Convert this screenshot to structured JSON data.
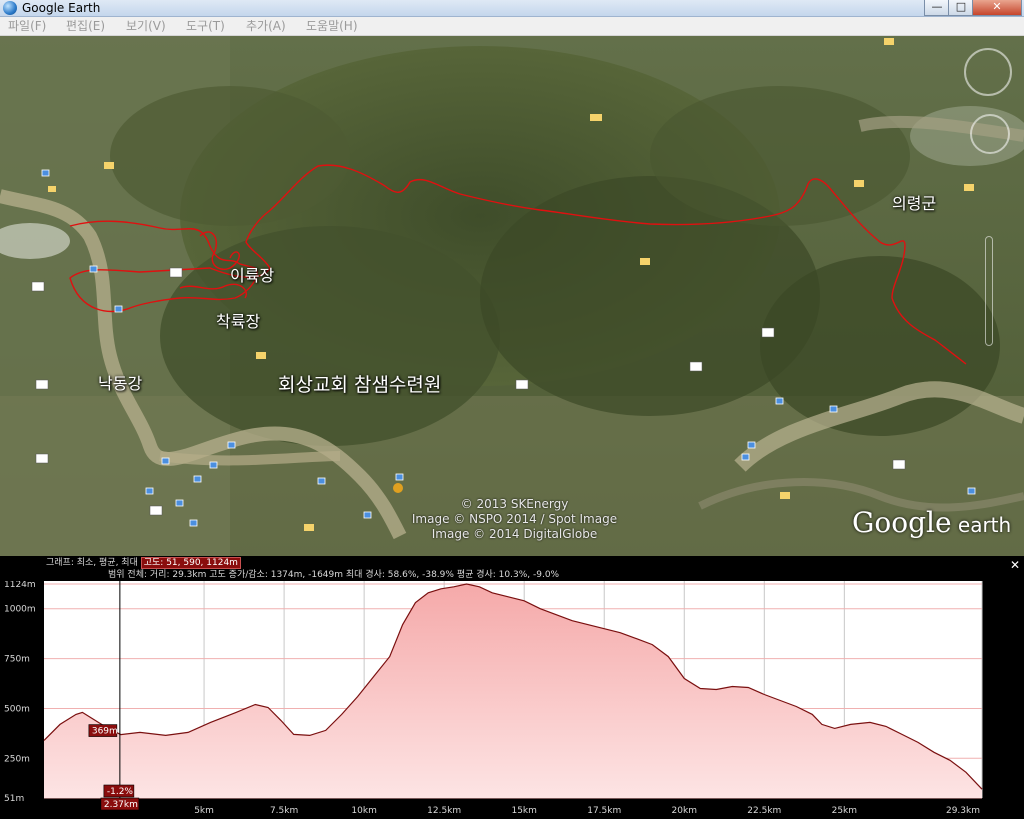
{
  "window": {
    "title": "Google Earth",
    "minimize_label": "—",
    "maximize_label": "□",
    "close_label": "✕"
  },
  "menu": [
    "파일(F)",
    "편집(E)",
    "보기(V)",
    "도구(T)",
    "추가(A)",
    "도움말(H)"
  ],
  "map": {
    "places": [
      {
        "key": "iryukjang",
        "label": "이륙장"
      },
      {
        "key": "chakryukjang",
        "label": "착륙장"
      },
      {
        "key": "nakdonggang",
        "label": "낙동강"
      },
      {
        "key": "church",
        "label": "회상교회 참샘수련원"
      },
      {
        "key": "uiryeong",
        "label": "의령군"
      }
    ],
    "copyright": [
      "© 2013 SKEnergy",
      "Image © NSPO 2014 / Spot Image",
      "Image © 2014 DigitalGlobe"
    ],
    "brand_google": "Google",
    "brand_earth": " earth",
    "colors": {
      "track": "#e01010",
      "terrain": "#5d6b3e"
    }
  },
  "profile": {
    "stats_label": "그래프: 최소, 평균, 최대",
    "stats_elevation": "고도: 51, 590, 1124m",
    "range_label": "범위 전체:",
    "range_distance": "거리: 29.3km",
    "range_gain_loss": "고도 증가/감소: 1374m, -1649m",
    "range_max_slope": "최대 경사: 58.6%, -38.9%",
    "range_avg_slope": "평균 경사: 10.3%, -9.0%",
    "cursor_elevation": "369m",
    "cursor_slope": "-1.2%",
    "cursor_distance": "2.37km",
    "close_label": "✕"
  },
  "chart_data": {
    "type": "area",
    "xlabel": "",
    "ylabel": "",
    "xlim": [
      0,
      29.3
    ],
    "ylim": [
      51,
      1124
    ],
    "x_ticks": [
      5,
      7.5,
      10,
      12.5,
      15,
      17.5,
      20,
      22.5,
      25,
      29.3
    ],
    "x_tick_labels": [
      "5km",
      "7.5km",
      "10km",
      "12.5km",
      "15km",
      "17.5km",
      "20km",
      "22.5km",
      "25km",
      "29.3km"
    ],
    "y_ticks": [
      51,
      250,
      500,
      750,
      1000,
      1124
    ],
    "y_tick_labels": [
      "51m",
      "250m",
      "500m",
      "750m",
      "1000m",
      "1124m"
    ],
    "grid": true,
    "series": [
      {
        "x": [
          0,
          0.5,
          1.0,
          1.2,
          1.6,
          2.0,
          2.4,
          3.0,
          3.8,
          4.5,
          5.2,
          6.0,
          6.6,
          7.0,
          7.4,
          7.8,
          8.3,
          8.8,
          9.3,
          9.8,
          10.3,
          10.8,
          11.2,
          11.6,
          12.0,
          12.4,
          12.8,
          13.2,
          13.6,
          14.0,
          14.5,
          15.0,
          15.5,
          16.0,
          16.5,
          17.0,
          17.5,
          18.0,
          18.5,
          19.0,
          19.5,
          20.0,
          20.5,
          21.0,
          21.5,
          22.0,
          22.5,
          23.0,
          23.5,
          24.0,
          24.3,
          24.7,
          25.2,
          25.8,
          26.3,
          26.8,
          27.3,
          27.8,
          28.3,
          28.8,
          29.3
        ],
        "y": [
          340,
          420,
          470,
          480,
          440,
          400,
          369,
          380,
          365,
          380,
          430,
          480,
          520,
          505,
          440,
          370,
          365,
          390,
          470,
          560,
          660,
          760,
          920,
          1030,
          1080,
          1100,
          1110,
          1124,
          1110,
          1080,
          1060,
          1040,
          1000,
          970,
          940,
          920,
          900,
          880,
          850,
          820,
          760,
          650,
          600,
          595,
          610,
          605,
          570,
          540,
          510,
          470,
          420,
          400,
          420,
          430,
          410,
          370,
          330,
          280,
          240,
          180,
          95
        ]
      }
    ]
  }
}
